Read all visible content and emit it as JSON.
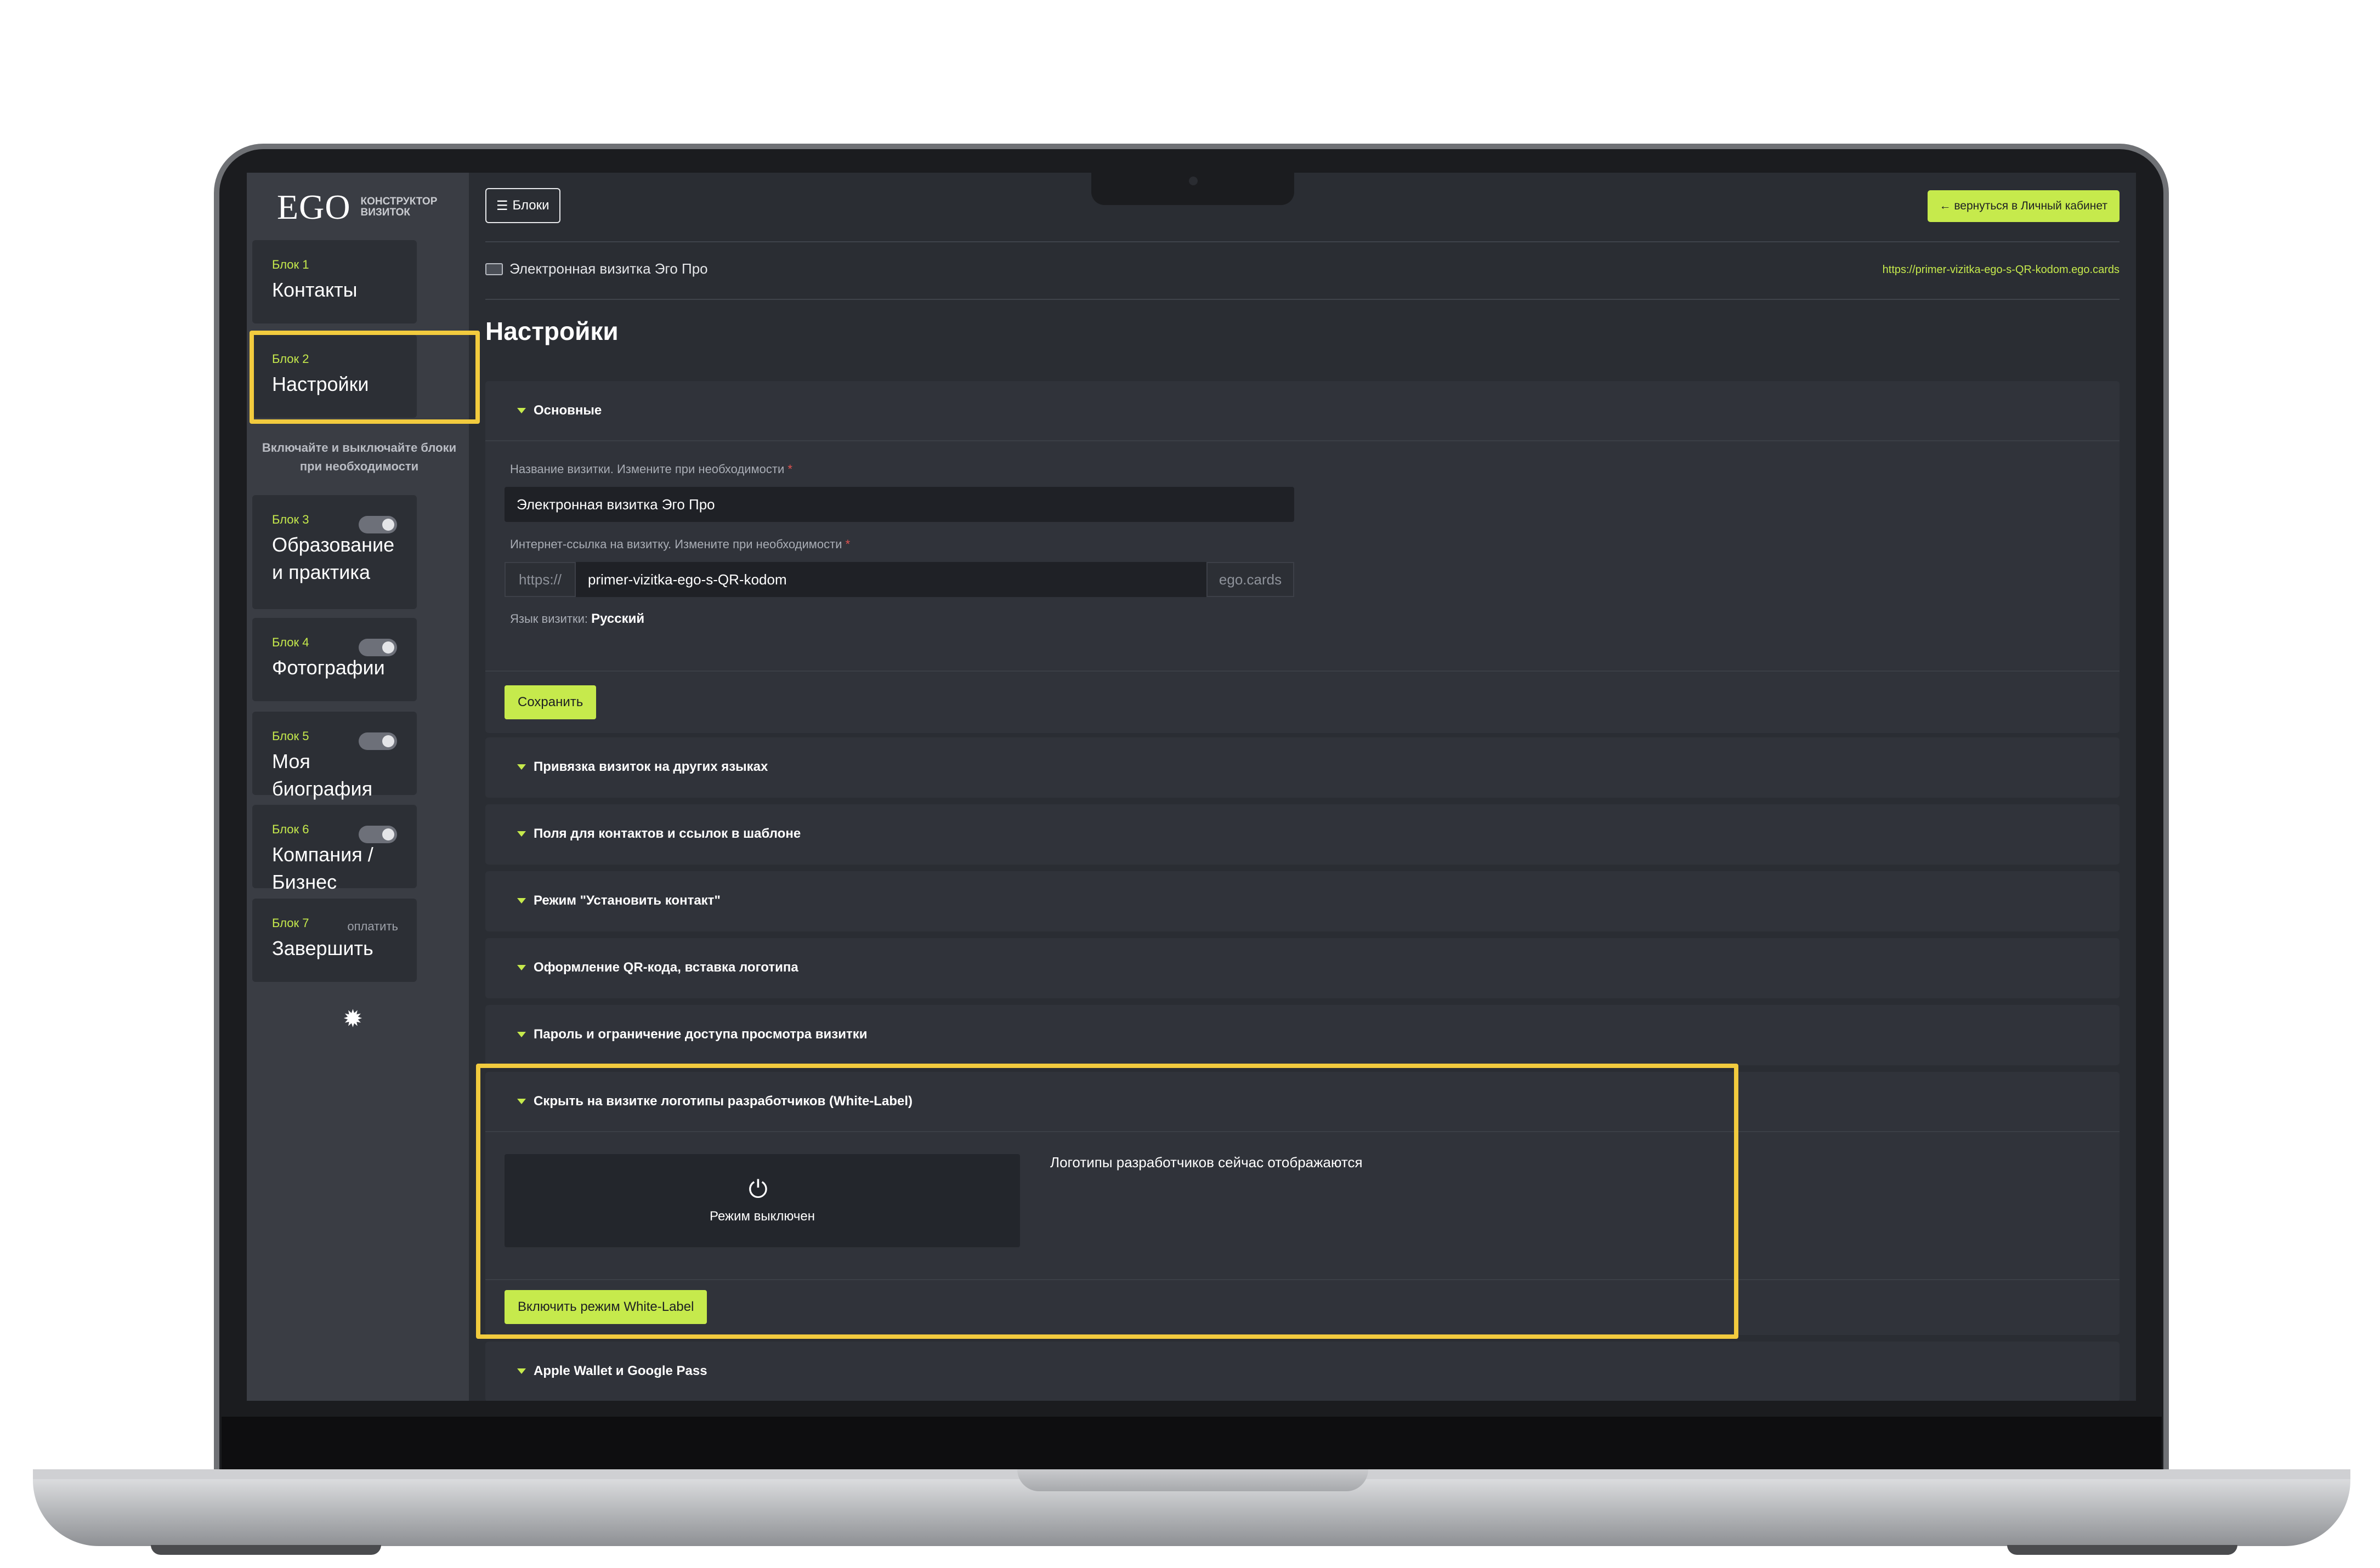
{
  "sidebar": {
    "logo_main": "EGO",
    "logo_sub_1": "КОНСТРУКТОР",
    "logo_sub_2": "ВИЗИТОК",
    "hint": "Включайте и выключайте блоки при необходимости",
    "blocks": [
      {
        "num": "Блок 1",
        "title": "Контакты"
      },
      {
        "num": "Блок 2",
        "title": "Настройки"
      },
      {
        "num": "Блок 3",
        "title": "Образование и практика",
        "toggle": true
      },
      {
        "num": "Блок 4",
        "title": "Фотографии",
        "toggle": true
      },
      {
        "num": "Блок 5",
        "title": "Моя биография",
        "toggle": true
      },
      {
        "num": "Блок 6",
        "title": "Компания / Бизнес",
        "toggle": true
      },
      {
        "num": "Блок 7",
        "title": "Завершить",
        "badge": "оплатить"
      }
    ],
    "gear_icon": "gear-icon"
  },
  "header": {
    "blocks_button": "Блоки",
    "back_button": "← вернуться в Личный кабинет",
    "breadcrumb": "Электронная визитка Эго Про",
    "url": "https://primer-vizitka-ego-s-QR-kodom.ego.cards"
  },
  "page_title": "Настройки",
  "basic": {
    "header": "Основные",
    "name_label": "Название визитки. Измените при необходимости",
    "name_value": "Электронная визитка Эго Про",
    "link_label": "Интернет-ссылка на визитку. Измените при необходимости",
    "link_prefix": "https://",
    "link_value": "primer-vizitka-ego-s-QR-kodom",
    "link_suffix": "ego.cards",
    "lang_label": "Язык визитки:",
    "lang_value": "Русский",
    "save_button": "Сохранить",
    "required_mark": "*"
  },
  "sections": [
    "Привязка визиток на других языках",
    "Поля для контактов и ссылок в шаблоне",
    "Режим \"Установить контакт\"",
    "Оформление QR-кода, вставка логотипа",
    "Пароль и ограничение доступа просмотра визитки"
  ],
  "white_label": {
    "header": "Скрыть на визитке логотипы разработчиков (White-Label)",
    "mode_label": "Режим выключен",
    "status": "Логотипы разработчиков сейчас отображаются",
    "enable_button": "Включить режим White-Label"
  },
  "last_section": "Apple Wallet и Google Pass",
  "colors": {
    "accent": "#c6ea4c",
    "highlight": "#f2cb3e",
    "background": "#2a2d33"
  }
}
